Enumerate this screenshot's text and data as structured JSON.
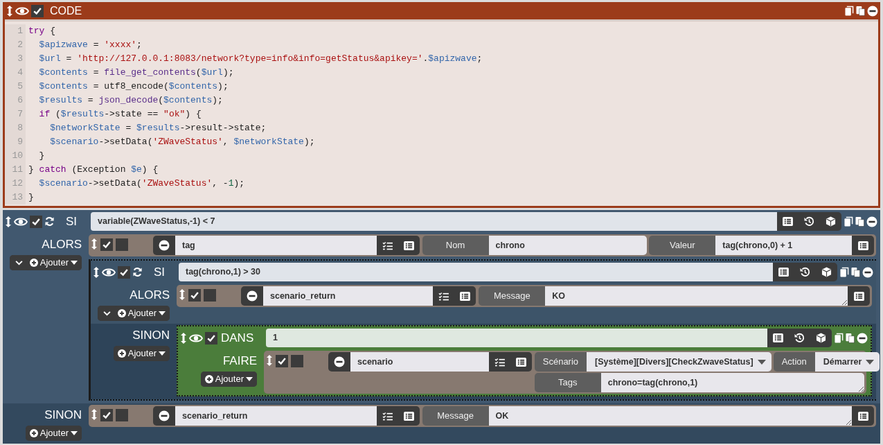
{
  "blocks": [
    {
      "kind": "code",
      "title": "CODE",
      "visible": true,
      "enabled": true,
      "lines": [
        {
          "number": "1",
          "tokens": [
            {
              "kind": "keyword",
              "text": "try"
            },
            {
              "kind": "plain",
              "text": " {"
            }
          ]
        },
        {
          "number": "2",
          "tokens": [
            {
              "kind": "variable",
              "text": "  $apizwave"
            },
            {
              "kind": "plain",
              "text": " = "
            },
            {
              "kind": "string",
              "text": "'xxxx'"
            },
            {
              "kind": "plain",
              "text": ";"
            }
          ]
        },
        {
          "number": "3",
          "tokens": [
            {
              "kind": "variable",
              "text": "  $url"
            },
            {
              "kind": "plain",
              "text": " = "
            },
            {
              "kind": "string",
              "text": "'http://127.0.0.1:8083/network?type=info&info=getStatus&apikey='"
            },
            {
              "kind": "plain",
              "text": "."
            },
            {
              "kind": "variable",
              "text": "$apizwave"
            },
            {
              "kind": "plain",
              "text": ";"
            }
          ]
        },
        {
          "number": "4",
          "tokens": [
            {
              "kind": "variable",
              "text": "  $contents"
            },
            {
              "kind": "plain",
              "text": " = "
            },
            {
              "kind": "builtin",
              "text": "file_get_contents"
            },
            {
              "kind": "plain",
              "text": "("
            },
            {
              "kind": "variable",
              "text": "$url"
            },
            {
              "kind": "plain",
              "text": ");"
            }
          ]
        },
        {
          "number": "5",
          "tokens": [
            {
              "kind": "variable",
              "text": "  $contents"
            },
            {
              "kind": "plain",
              "text": " = utf8_encode("
            },
            {
              "kind": "variable",
              "text": "$contents"
            },
            {
              "kind": "plain",
              "text": ");"
            }
          ]
        },
        {
          "number": "6",
          "tokens": [
            {
              "kind": "variable",
              "text": "  $results"
            },
            {
              "kind": "plain",
              "text": " = "
            },
            {
              "kind": "builtin",
              "text": "json_decode"
            },
            {
              "kind": "plain",
              "text": "("
            },
            {
              "kind": "variable",
              "text": "$contents"
            },
            {
              "kind": "plain",
              "text": ");"
            }
          ]
        },
        {
          "number": "7",
          "tokens": [
            {
              "kind": "keyword",
              "text": "  if"
            },
            {
              "kind": "plain",
              "text": " ("
            },
            {
              "kind": "variable",
              "text": "$results"
            },
            {
              "kind": "plain",
              "text": "->state == "
            },
            {
              "kind": "string",
              "text": "\"ok\""
            },
            {
              "kind": "plain",
              "text": ") {"
            }
          ]
        },
        {
          "number": "8",
          "tokens": [
            {
              "kind": "variable",
              "text": "    $networkState"
            },
            {
              "kind": "plain",
              "text": " = "
            },
            {
              "kind": "variable",
              "text": "$results"
            },
            {
              "kind": "plain",
              "text": "->result->state;"
            }
          ]
        },
        {
          "number": "9",
          "tokens": [
            {
              "kind": "variable",
              "text": "    $scenario"
            },
            {
              "kind": "plain",
              "text": "->setData("
            },
            {
              "kind": "string",
              "text": "'ZWaveStatus'"
            },
            {
              "kind": "plain",
              "text": ", "
            },
            {
              "kind": "variable",
              "text": "$networkState"
            },
            {
              "kind": "plain",
              "text": ");"
            }
          ]
        },
        {
          "number": "10",
          "tokens": [
            {
              "kind": "plain",
              "text": "  }"
            }
          ]
        },
        {
          "number": "11",
          "tokens": [
            {
              "kind": "plain",
              "text": "} "
            },
            {
              "kind": "keyword",
              "text": "catch"
            },
            {
              "kind": "plain",
              "text": " (Exception "
            },
            {
              "kind": "variable",
              "text": "$e"
            },
            {
              "kind": "plain",
              "text": ") {"
            }
          ]
        },
        {
          "number": "12",
          "tokens": [
            {
              "kind": "variable",
              "text": "  $scenario"
            },
            {
              "kind": "plain",
              "text": "->setData("
            },
            {
              "kind": "string",
              "text": "'ZWaveStatus'"
            },
            {
              "kind": "plain",
              "text": ", -"
            },
            {
              "kind": "number",
              "text": "1"
            },
            {
              "kind": "plain",
              "text": ");"
            }
          ]
        },
        {
          "number": "13",
          "tokens": [
            {
              "kind": "plain",
              "text": "}"
            }
          ]
        }
      ]
    },
    {
      "kind": "if",
      "keyword": "SI",
      "visible": true,
      "enabled": true,
      "condition": "variable(ZWaveStatus,-1) < 7",
      "sections": [
        {
          "kind": "then",
          "label": "ALORS",
          "collapsible": true,
          "add_label": "Ajouter",
          "items": [
            {
              "kind": "action",
              "enabled": true,
              "parallel": false,
              "command": "tag",
              "rows": [
                [
                  {
                    "kind": "text",
                    "label": "Nom",
                    "value": "chrono",
                    "picker": false
                  },
                  {
                    "kind": "text",
                    "label": "Valeur",
                    "value": "tag(chrono,0) + 1",
                    "picker": true
                  }
                ]
              ]
            },
            {
              "kind": "if",
              "keyword": "SI",
              "visible": true,
              "enabled": true,
              "condition": "tag(chrono,1) > 30",
              "sections": [
                {
                  "kind": "then",
                  "label": "ALORS",
                  "collapsible": true,
                  "add_label": "Ajouter",
                  "items": [
                    {
                      "kind": "action",
                      "enabled": true,
                      "parallel": false,
                      "command": "scenario_return",
                      "rows": [
                        [
                          {
                            "kind": "textarea",
                            "label": "Message",
                            "value": "KO",
                            "picker": true
                          }
                        ]
                      ]
                    }
                  ]
                },
                {
                  "kind": "else",
                  "label": "SINON",
                  "collapsible": false,
                  "add_label": "Ajouter",
                  "items": [
                    {
                      "kind": "in",
                      "keyword": "DANS",
                      "visible": true,
                      "enabled": true,
                      "condition": "1",
                      "sections": [
                        {
                          "kind": "do",
                          "label": "FAIRE",
                          "collapsible": false,
                          "add_label": "Ajouter",
                          "items": [
                            {
                              "kind": "action",
                              "enabled": true,
                              "parallel": false,
                              "command": "scenario",
                              "rows": [
                                [
                                  {
                                    "kind": "select",
                                    "label": "Scénario",
                                    "value": "[Système][Divers][CheckZwaveStatus]",
                                    "picker": false
                                  },
                                  {
                                    "kind": "select",
                                    "label": "Action",
                                    "value": "Démarrer",
                                    "picker": false
                                  }
                                ],
                                [
                                  {
                                    "kind": "textarea",
                                    "label": "Tags",
                                    "value": "chrono=tag(chrono,1)",
                                    "picker": false
                                  }
                                ]
                              ]
                            }
                          ]
                        }
                      ]
                    }
                  ]
                }
              ]
            }
          ]
        },
        {
          "kind": "else",
          "label": "SINON",
          "collapsible": false,
          "add_label": "Ajouter",
          "items": [
            {
              "kind": "action",
              "enabled": true,
              "parallel": false,
              "command": "scenario_return",
              "rows": [
                [
                  {
                    "kind": "textarea",
                    "label": "Message",
                    "value": "OK",
                    "picker": true
                  }
                ]
              ]
            }
          ]
        }
      ]
    }
  ]
}
